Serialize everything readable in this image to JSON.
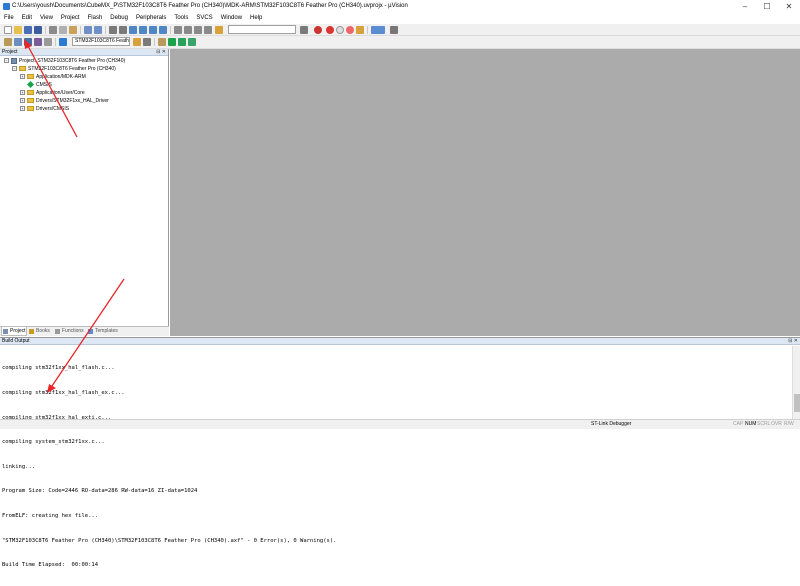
{
  "window": {
    "title": "C:\\Users\\yoush\\Documents\\CubeMX_P\\STM32F103C8T6 Feather Pro (CH340)\\MDK-ARM\\STM32F103C8T6 Feather Pro (CH340).uvprojx - µVision",
    "controls": [
      "–",
      "☐",
      "✕"
    ]
  },
  "menu": [
    "File",
    "Edit",
    "View",
    "Project",
    "Flash",
    "Debug",
    "Peripherals",
    "Tools",
    "SVCS",
    "Window",
    "Help"
  ],
  "toolbar": {
    "target_combo": "STM32F103C8T6 Feather"
  },
  "project_panel": {
    "header": "Project",
    "pin": "⊟ ✕",
    "tree": [
      {
        "label": "Project: STM32F103C8T6 Feather Pro (CH340)",
        "expander": "−"
      },
      {
        "label": "STM32F103C8T6 Feather Pro (CH340)",
        "expander": "−"
      },
      {
        "label": "Application/MDK-ARM",
        "expander": "+"
      },
      {
        "label": "CMSIS",
        "expander": ""
      },
      {
        "label": "Application/User/Core",
        "expander": "+"
      },
      {
        "label": "Drivers/STM32F1xx_HAL_Driver",
        "expander": "+"
      },
      {
        "label": "Drivers/CMSIS",
        "expander": "+"
      }
    ],
    "tabs": [
      "Project",
      "Books",
      "Functions",
      "Templates"
    ]
  },
  "build_output": {
    "header": "Build Output",
    "pin": "⊟ ✕",
    "lines": [
      "compiling stm32f1xx_hal_flash.c...",
      "compiling stm32f1xx_hal_flash_ex.c...",
      "compiling stm32f1xx_hal_exti.c...",
      "compiling system_stm32f1xx.c...",
      "linking...",
      "Program Size: Code=2446 RO-data=286 RW-data=16 ZI-data=1024",
      "FromELF: creating hex file...",
      "\"STM32F103C8T6 Feather Pro (CH340)\\STM32F103C8T6 Feather Pro (CH340).axf\" - 0 Error(s), 0 Warning(s).",
      "Build Time Elapsed:  00:00:14"
    ]
  },
  "status_bar": {
    "debugger": "ST-Link Debugger",
    "indicators": [
      {
        "label": "CAP",
        "active": false
      },
      {
        "label": "NUM",
        "active": true
      },
      {
        "label": "SCRL",
        "active": false
      },
      {
        "label": "OVR",
        "active": false
      },
      {
        "label": "R/W",
        "active": false
      }
    ]
  },
  "colors": {
    "arrow": "#e8262a",
    "editor_bg": "#ababab",
    "panel_header": "#dde7f3"
  }
}
